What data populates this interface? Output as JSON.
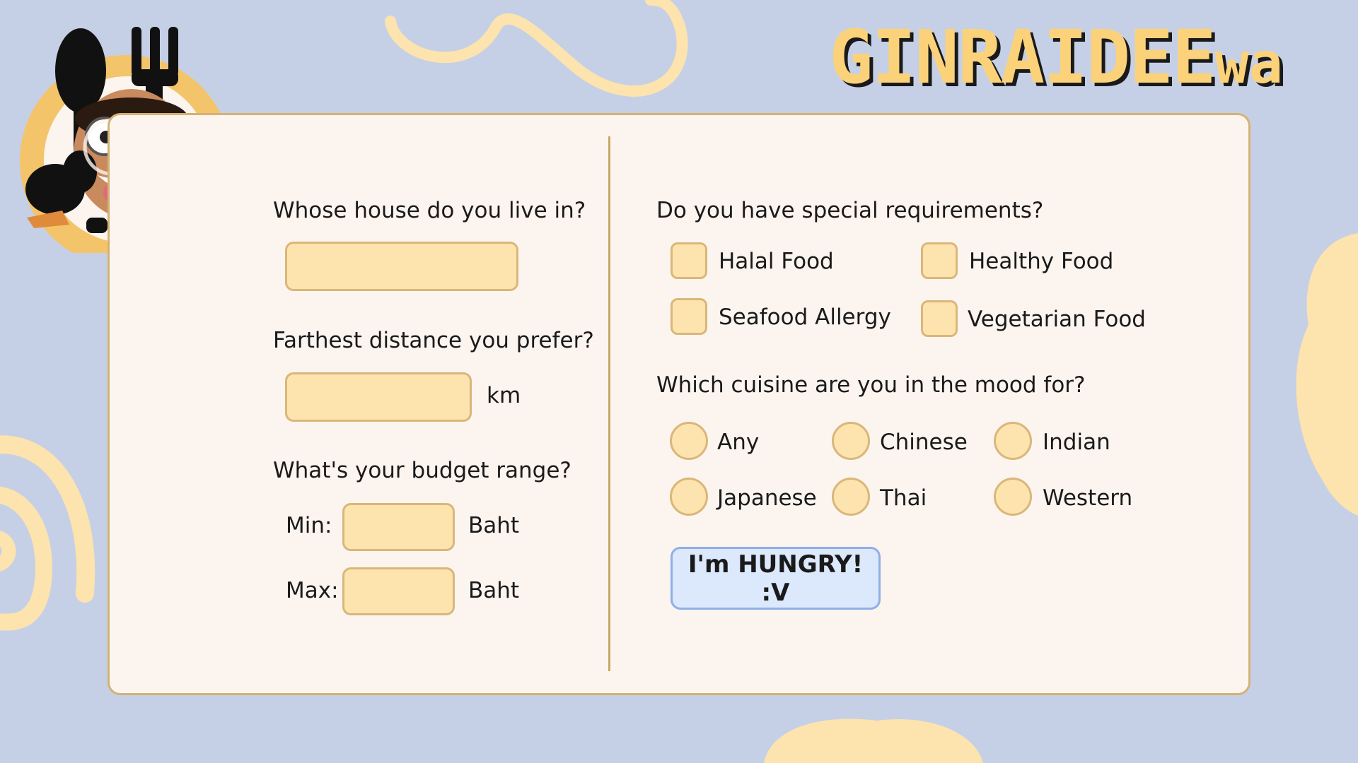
{
  "app": {
    "title_main": "GINRAIDEE",
    "title_suffix": "wa"
  },
  "left": {
    "house_question": "Whose house do you live in?",
    "house_value": "",
    "distance_question": "Farthest distance you prefer?",
    "distance_value": "",
    "distance_unit": "km",
    "budget_question": "What's your budget range?",
    "min_label": "Min:",
    "min_value": "",
    "min_unit": "Baht",
    "max_label": "Max:",
    "max_value": "",
    "max_unit": "Baht"
  },
  "right": {
    "requirements_question": "Do you have special requirements?",
    "requirements": [
      {
        "label": "Halal Food",
        "checked": false
      },
      {
        "label": "Healthy Food",
        "checked": false
      },
      {
        "label": "Seafood Allergy",
        "checked": false
      },
      {
        "label": "Vegetarian Food",
        "checked": false
      }
    ],
    "cuisine_question": "Which cuisine are you in the mood for?",
    "cuisines": [
      {
        "label": "Any",
        "selected": false
      },
      {
        "label": "Chinese",
        "selected": false
      },
      {
        "label": "Indian",
        "selected": false
      },
      {
        "label": "Japanese",
        "selected": false
      },
      {
        "label": "Thai",
        "selected": false
      },
      {
        "label": "Western",
        "selected": false
      }
    ],
    "submit_label": "I'm HUNGRY! :V"
  },
  "colors": {
    "background": "#c5d0e6",
    "panel": "#fcf4ef",
    "accent_yellow": "#fde3ad",
    "border_gold": "#d9b77a",
    "button_blue": "#dce8fb"
  },
  "icons": [
    "spoon-icon",
    "fork-icon",
    "avatar-photo"
  ]
}
